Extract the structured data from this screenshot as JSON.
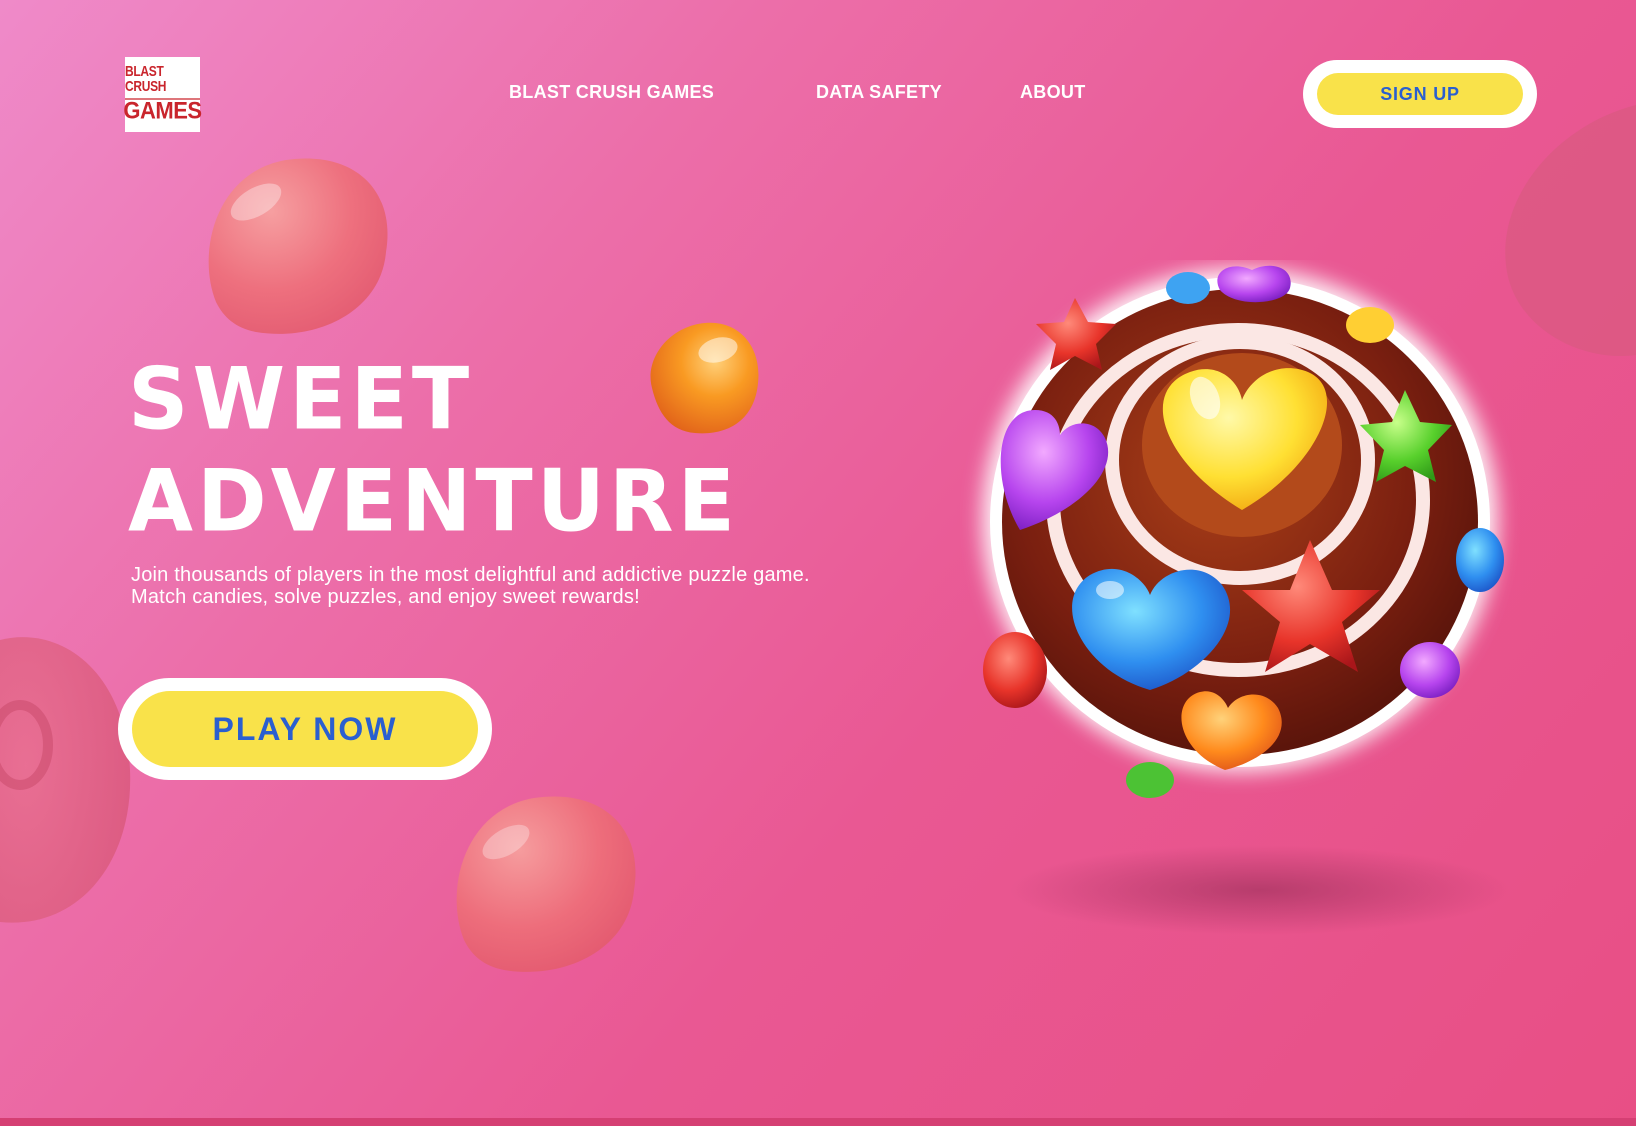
{
  "logo": {
    "line1": "BLAST CRUSH",
    "line2": "GAMES"
  },
  "nav": {
    "items": [
      {
        "label": "BLAST CRUSH GAMES"
      },
      {
        "label": "DATA SAFETY"
      },
      {
        "label": "ABOUT"
      }
    ],
    "signup_label": "SIGN UP"
  },
  "hero": {
    "title_line1": "SWEET",
    "title_line2": "ADVENTURE",
    "description": "Join thousands of players in the most delightful and addictive puzzle game. Match candies, solve puzzles, and enjoy sweet rewards!",
    "cta_label": "PLAY NOW"
  },
  "colors": {
    "background": "#ea5f98",
    "accent_yellow": "#f9e24a",
    "button_text_blue": "#2a5fd0",
    "logo_red": "#c9252c"
  },
  "icons": [
    "blast-crush-logo",
    "candy-decoration",
    "candy-cake-illustration"
  ]
}
